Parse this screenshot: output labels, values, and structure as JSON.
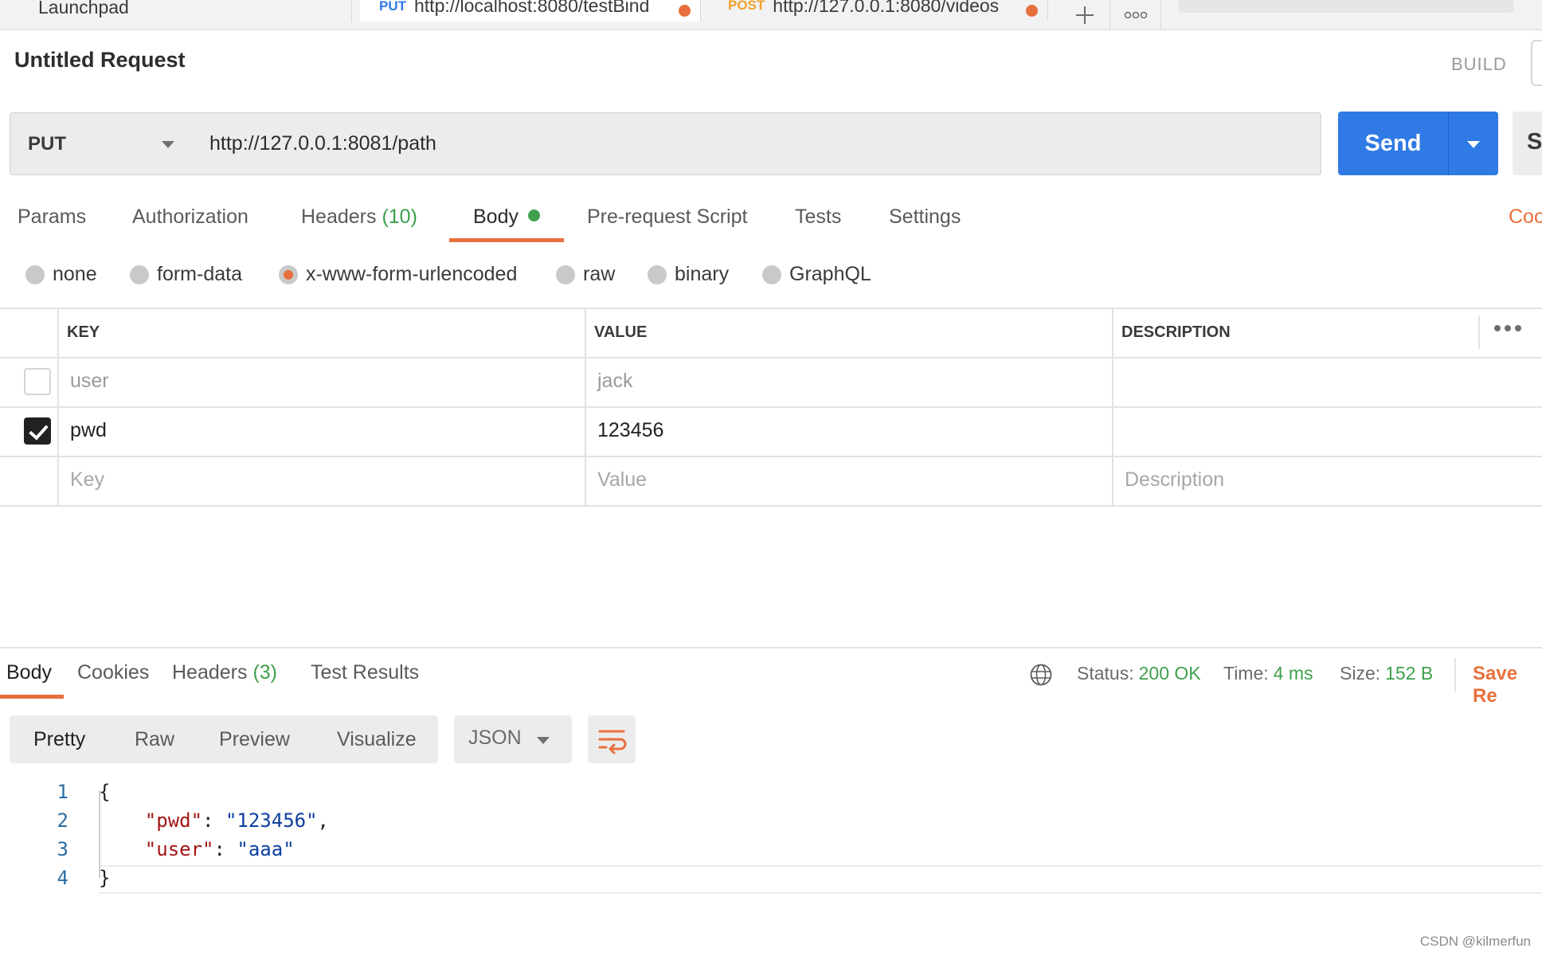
{
  "tabs": [
    {
      "label": "Launchpad"
    },
    {
      "method": "PUT",
      "url": "http://localhost:8080/testBind",
      "method_color": "#2f7ae5"
    },
    {
      "method": "POST",
      "url": "http://127.0.0.1:8080/videos",
      "method_color": "#f0a22c"
    }
  ],
  "request": {
    "title": "Untitled Request",
    "build_label": "BUILD",
    "method": "PUT",
    "url": "http://127.0.0.1:8081/path",
    "send_label": "Send",
    "save_label_cut": "Sa"
  },
  "request_tabs": [
    {
      "label": "Params"
    },
    {
      "label": "Authorization"
    },
    {
      "label": "Headers",
      "count": "(10)"
    },
    {
      "label": "Body"
    },
    {
      "label": "Pre-request Script"
    },
    {
      "label": "Tests"
    },
    {
      "label": "Settings"
    }
  ],
  "cookies_label_cut": "Coo",
  "body_types": [
    "none",
    "form-data",
    "x-www-form-urlencoded",
    "raw",
    "binary",
    "GraphQL"
  ],
  "body_type_selected": "x-www-form-urlencoded",
  "kv_table": {
    "headers": [
      "KEY",
      "VALUE",
      "DESCRIPTION"
    ],
    "rows": [
      {
        "key": "user",
        "value": "jack",
        "description": "",
        "checked": false
      },
      {
        "key": "pwd",
        "value": "123456",
        "description": "",
        "checked": true
      }
    ],
    "placeholders": {
      "key": "Key",
      "value": "Value",
      "description": "Description"
    }
  },
  "response": {
    "tabs": [
      {
        "label": "Body"
      },
      {
        "label": "Cookies"
      },
      {
        "label": "Headers",
        "count": "(3)"
      },
      {
        "label": "Test Results"
      }
    ],
    "status_label": "Status:",
    "status": "200 OK",
    "time_label": "Time:",
    "time": "4 ms",
    "size_label": "Size:",
    "size": "152 B",
    "save_label_cut": "Save Re",
    "views": [
      "Pretty",
      "Raw",
      "Preview",
      "Visualize"
    ],
    "format": "JSON",
    "line_numbers": [
      "1",
      "2",
      "3",
      "4"
    ],
    "code": {
      "open": "{",
      "k1": "\"pwd\"",
      "v1": "\"123456\"",
      "k2": "\"user\"",
      "v2": "\"aaa\"",
      "close": "}"
    }
  },
  "watermark": "CSDN @kilmerfun",
  "colors": {
    "accent": "#e8703c",
    "send": "#2f7ae5",
    "success": "#3ea04c"
  }
}
